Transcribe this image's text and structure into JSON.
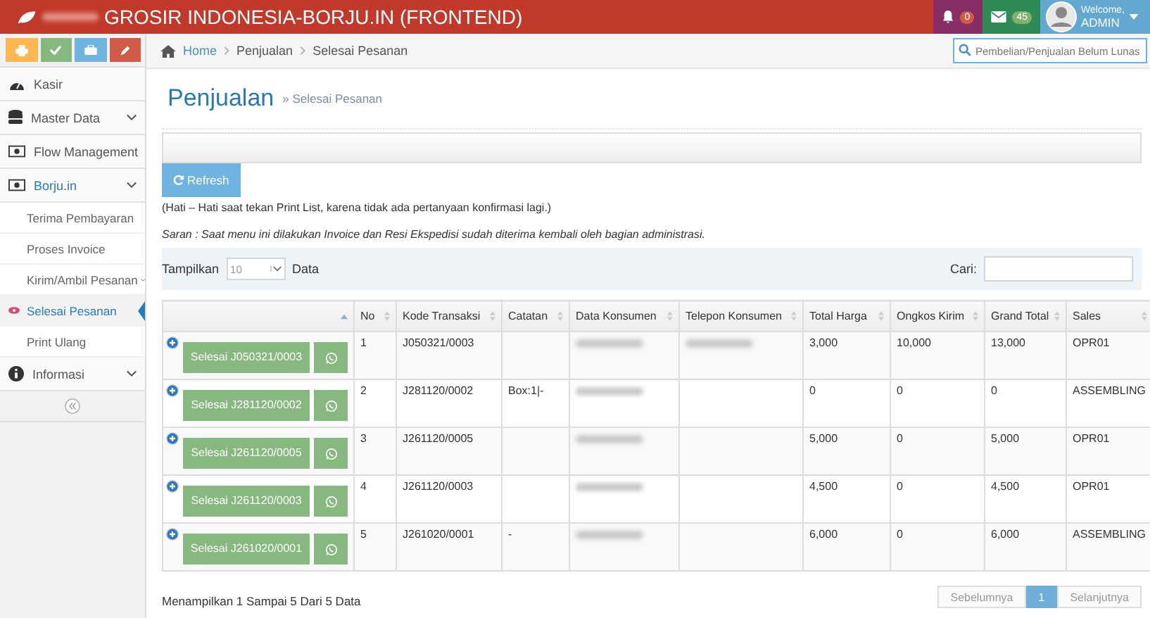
{
  "header": {
    "title": "GROSIR INDONESIA-BORJU.IN (FRONTEND)",
    "title_prefix_blurred": true,
    "notifications": "0",
    "messages": "45",
    "welcome": "Welcome,",
    "user": "ADMIN"
  },
  "sidebar": {
    "items": [
      {
        "label": "Kasir",
        "kind": "link",
        "expanded": false
      },
      {
        "label": "Master Data",
        "kind": "group",
        "expanded": false
      },
      {
        "label": "Flow Management",
        "kind": "group",
        "expanded": false
      },
      {
        "label": "Borju.in",
        "kind": "group",
        "expanded": true,
        "children": [
          {
            "label": "Terima Pembayaran",
            "kind": "link",
            "selected": false
          },
          {
            "label": "Proses Invoice",
            "kind": "link",
            "selected": false
          },
          {
            "label": "Kirim/Ambil Pesanan",
            "kind": "group",
            "selected": false
          },
          {
            "label": "Selesai Pesanan",
            "kind": "link",
            "selected": true
          },
          {
            "label": "Print Ulang",
            "kind": "link",
            "selected": false
          }
        ]
      },
      {
        "label": "Informasi",
        "kind": "group",
        "expanded": false
      }
    ]
  },
  "breadcrumb": [
    "Home",
    "Penjualan",
    "Selesai Pesanan"
  ],
  "search": {
    "placeholder": "Pembelian/Penjualan Belum Lunas"
  },
  "page": {
    "title": "Penjualan",
    "subtitle": "» Selesai Pesanan"
  },
  "refresh_button": "Refresh",
  "warning": "(Hati – Hati saat tekan Print List, karena tidak ada pertanyaan konfirmasi lagi.)",
  "suggestion": "Saran : Saat menu ini dilakukan Invoice dan Resi Ekspedisi sudah diterima kembali oleh bagian administrasi.",
  "length_menu": {
    "before": "Tampilkan",
    "value": "10",
    "after": "Data"
  },
  "filter_label": "Cari:",
  "table": {
    "columns": [
      "",
      "No",
      "Kode Transaksi",
      "Catatan",
      "Data Konsumen",
      "Telepon Konsumen",
      "Total Harga",
      "Ongkos Kirim",
      "Grand Total",
      "Sales"
    ],
    "rows": [
      {
        "action": "Selesai J050321/0003",
        "no": "1",
        "kode": "J050321/0003",
        "catatan": "",
        "consumer_blurred": true,
        "phone_blurred": true,
        "total": "3,000",
        "ongkir": "10,000",
        "grand": "13,000",
        "sales": "OPR01"
      },
      {
        "action": "Selesai J281120/0002",
        "no": "2",
        "kode": "J281120/0002",
        "catatan": "Box:1|-",
        "consumer_blurred": true,
        "phone_blurred": false,
        "total": "0",
        "ongkir": "0",
        "grand": "0",
        "sales": "ASSEMBLING"
      },
      {
        "action": "Selesai J261120/0005",
        "no": "3",
        "kode": "J261120/0005",
        "catatan": "",
        "consumer_blurred": true,
        "phone_blurred": false,
        "total": "5,000",
        "ongkir": "0",
        "grand": "5,000",
        "sales": "OPR01"
      },
      {
        "action": "Selesai J261120/0003",
        "no": "4",
        "kode": "J261120/0003",
        "catatan": "",
        "consumer_blurred": true,
        "phone_blurred": false,
        "total": "4,500",
        "ongkir": "0",
        "grand": "4,500",
        "sales": "OPR01"
      },
      {
        "action": "Selesai J261020/0001",
        "no": "5",
        "kode": "J261020/0001",
        "catatan": "-",
        "consumer_blurred": true,
        "phone_blurred": false,
        "total": "6,000",
        "ongkir": "0",
        "grand": "6,000",
        "sales": "ASSEMBLING"
      }
    ]
  },
  "info": "Menampilkan 1 Sampai 5 Dari 5 Data",
  "pagination": [
    {
      "label": "Sebelumnya",
      "selected": false
    },
    {
      "label": "1",
      "selected": true
    },
    {
      "label": "Selanjutnya",
      "selected": false
    }
  ]
}
